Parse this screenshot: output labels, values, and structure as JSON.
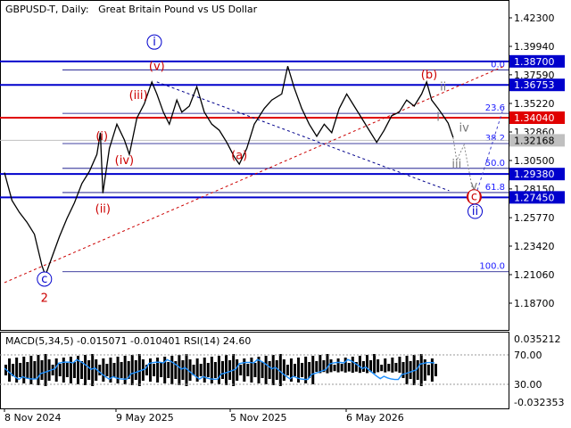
{
  "header": {
    "symbol": "GBPUSD-T, Daily:",
    "description": "Great Britain Pound vs US Dollar"
  },
  "indicator": {
    "label": "MACD(5,34,5) -0.015071 -0.010401 RSI(14) 24.60"
  },
  "colors": {
    "resistance": "#0000cc",
    "support_red": "#e00000",
    "wave_label_red": "#cc0000",
    "wave_label_blue": "#0000cc",
    "wave_label_gray": "#777777",
    "fib_line": "#1a1aff",
    "price_line": "#000000",
    "highlight_label_bg": "#0000cc",
    "current_label_bg": "#c0c0c0"
  },
  "chart_data": [
    {
      "type": "line",
      "name": "price",
      "y_range": [
        1.17,
        1.43
      ],
      "x_ticks": [
        "8 Nov 2024",
        "9 May 2025",
        "5 Nov 2025",
        "6 May 2026"
      ],
      "y_ticks": [
        "1.42300",
        "1.39940",
        "1.37590",
        "1.35220",
        "1.32860",
        "1.30500",
        "1.28150",
        "1.25770",
        "1.23420",
        "1.21060",
        "1.18700"
      ],
      "levels": [
        {
          "value": 1.387,
          "label": "1.38700",
          "style": "blue"
        },
        {
          "value": 1.36753,
          "label": "1.36753",
          "style": "blue"
        },
        {
          "value": 1.3404,
          "label": "1.34040",
          "style": "red"
        },
        {
          "value": 1.32168,
          "label": "1.32168",
          "style": "current"
        },
        {
          "value": 1.2938,
          "label": "1.29380",
          "style": "blue"
        },
        {
          "value": 1.2745,
          "label": "1.27450",
          "style": "blue"
        }
      ],
      "fibonacci": [
        {
          "level": "0.0",
          "value": 1.38
        },
        {
          "level": "23.6",
          "value": 1.344
        },
        {
          "level": "38.2",
          "value": 1.319
        },
        {
          "level": "50.0",
          "value": 1.2985
        },
        {
          "level": "61.8",
          "value": 1.2785
        },
        {
          "level": "100.0",
          "value": 1.213
        }
      ],
      "wave_labels": [
        {
          "text": "i",
          "color": "blue",
          "circled": true,
          "x": 0.3,
          "y": 1.4
        },
        {
          "text": "c",
          "color": "blue",
          "circled": true,
          "x": 0.08,
          "y": 1.204
        },
        {
          "text": "2",
          "color": "red",
          "circled": false,
          "x": 0.08,
          "y": 1.188
        },
        {
          "text": "(i)",
          "color": "red",
          "circled": false,
          "x": 0.195,
          "y": 1.322
        },
        {
          "text": "(ii)",
          "color": "red",
          "circled": false,
          "x": 0.197,
          "y": 1.262
        },
        {
          "text": "(iii)",
          "color": "red",
          "circled": false,
          "x": 0.268,
          "y": 1.356
        },
        {
          "text": "(iv)",
          "color": "red",
          "circled": false,
          "x": 0.24,
          "y": 1.302
        },
        {
          "text": "(v)",
          "color": "red",
          "circled": false,
          "x": 0.305,
          "y": 1.38
        },
        {
          "text": "(a)",
          "color": "red",
          "circled": false,
          "x": 0.47,
          "y": 1.306
        },
        {
          "text": "(b)",
          "color": "red",
          "circled": false,
          "x": 0.85,
          "y": 1.373
        },
        {
          "text": "(c)",
          "color": "red",
          "circled": true,
          "x": 0.94,
          "y": 1.272
        },
        {
          "text": "ii",
          "color": "blue",
          "circled": true,
          "x": 0.942,
          "y": 1.26
        },
        {
          "text": "i",
          "color": "gray",
          "circled": false,
          "x": 0.868,
          "y": 1.338
        },
        {
          "text": "ii",
          "color": "gray",
          "circled": false,
          "x": 0.878,
          "y": 1.363
        },
        {
          "text": "iii",
          "color": "gray",
          "circled": false,
          "x": 0.905,
          "y": 1.299
        },
        {
          "text": "iv",
          "color": "gray",
          "circled": false,
          "x": 0.92,
          "y": 1.329
        },
        {
          "text": "v",
          "color": "gray",
          "circled": false,
          "x": 0.94,
          "y": 1.281
        }
      ],
      "series": [
        {
          "x": 0.0,
          "y": 1.295
        },
        {
          "x": 0.015,
          "y": 1.272
        },
        {
          "x": 0.03,
          "y": 1.262
        },
        {
          "x": 0.045,
          "y": 1.254
        },
        {
          "x": 0.06,
          "y": 1.244
        },
        {
          "x": 0.075,
          "y": 1.218
        },
        {
          "x": 0.082,
          "y": 1.21
        },
        {
          "x": 0.095,
          "y": 1.225
        },
        {
          "x": 0.11,
          "y": 1.242
        },
        {
          "x": 0.125,
          "y": 1.257
        },
        {
          "x": 0.14,
          "y": 1.27
        },
        {
          "x": 0.155,
          "y": 1.286
        },
        {
          "x": 0.17,
          "y": 1.296
        },
        {
          "x": 0.185,
          "y": 1.31
        },
        {
          "x": 0.192,
          "y": 1.328
        },
        {
          "x": 0.197,
          "y": 1.278
        },
        {
          "x": 0.21,
          "y": 1.315
        },
        {
          "x": 0.225,
          "y": 1.335
        },
        {
          "x": 0.24,
          "y": 1.322
        },
        {
          "x": 0.25,
          "y": 1.31
        },
        {
          "x": 0.265,
          "y": 1.34
        },
        {
          "x": 0.28,
          "y": 1.352
        },
        {
          "x": 0.295,
          "y": 1.37
        },
        {
          "x": 0.305,
          "y": 1.36
        },
        {
          "x": 0.318,
          "y": 1.345
        },
        {
          "x": 0.33,
          "y": 1.335
        },
        {
          "x": 0.345,
          "y": 1.355
        },
        {
          "x": 0.355,
          "y": 1.345
        },
        {
          "x": 0.37,
          "y": 1.35
        },
        {
          "x": 0.385,
          "y": 1.366
        },
        {
          "x": 0.4,
          "y": 1.345
        },
        {
          "x": 0.415,
          "y": 1.335
        },
        {
          "x": 0.43,
          "y": 1.33
        },
        {
          "x": 0.445,
          "y": 1.32
        },
        {
          "x": 0.46,
          "y": 1.308
        },
        {
          "x": 0.47,
          "y": 1.302
        },
        {
          "x": 0.485,
          "y": 1.315
        },
        {
          "x": 0.5,
          "y": 1.335
        },
        {
          "x": 0.52,
          "y": 1.348
        },
        {
          "x": 0.535,
          "y": 1.355
        },
        {
          "x": 0.555,
          "y": 1.36
        },
        {
          "x": 0.567,
          "y": 1.383
        },
        {
          "x": 0.58,
          "y": 1.365
        },
        {
          "x": 0.595,
          "y": 1.348
        },
        {
          "x": 0.61,
          "y": 1.335
        },
        {
          "x": 0.625,
          "y": 1.325
        },
        {
          "x": 0.64,
          "y": 1.335
        },
        {
          "x": 0.655,
          "y": 1.328
        },
        {
          "x": 0.67,
          "y": 1.348
        },
        {
          "x": 0.685,
          "y": 1.36
        },
        {
          "x": 0.7,
          "y": 1.35
        },
        {
          "x": 0.715,
          "y": 1.34
        },
        {
          "x": 0.73,
          "y": 1.33
        },
        {
          "x": 0.745,
          "y": 1.32
        },
        {
          "x": 0.76,
          "y": 1.33
        },
        {
          "x": 0.775,
          "y": 1.342
        },
        {
          "x": 0.79,
          "y": 1.345
        },
        {
          "x": 0.805,
          "y": 1.355
        },
        {
          "x": 0.82,
          "y": 1.35
        },
        {
          "x": 0.835,
          "y": 1.36
        },
        {
          "x": 0.845,
          "y": 1.37
        },
        {
          "x": 0.855,
          "y": 1.355
        },
        {
          "x": 0.868,
          "y": 1.348
        },
        {
          "x": 0.878,
          "y": 1.342
        },
        {
          "x": 0.888,
          "y": 1.336
        },
        {
          "x": 0.898,
          "y": 1.324
        }
      ]
    },
    {
      "type": "area",
      "name": "macd",
      "y_ticks": [
        "0.035212",
        "70.00",
        "30.00",
        "-0.032353"
      ]
    }
  ]
}
